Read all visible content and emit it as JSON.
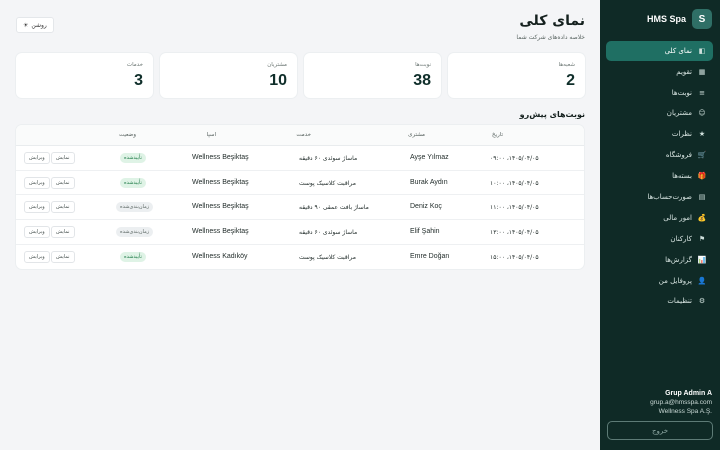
{
  "sidebar": {
    "brand_name": "HMS Spa",
    "brand_initial": "S",
    "items": [
      {
        "label": "نمای کلی",
        "icon": "◧"
      },
      {
        "label": "تقویم",
        "icon": "▦"
      },
      {
        "label": "نوبت‌ها",
        "icon": "≡"
      },
      {
        "label": "مشتریان",
        "icon": "☺"
      },
      {
        "label": "نظرات",
        "icon": "★"
      },
      {
        "label": "فروشگاه",
        "icon": "🛒"
      },
      {
        "label": "بسته‌ها",
        "icon": "🎁"
      },
      {
        "label": "صورت‌حساب‌ها",
        "icon": "▤"
      },
      {
        "label": "امور مالی",
        "icon": "💰"
      },
      {
        "label": "کارکنان",
        "icon": "⚑"
      },
      {
        "label": "گزارش‌ها",
        "icon": "📊"
      },
      {
        "label": "پروفایل من",
        "icon": "👤"
      },
      {
        "label": "تنظیمات",
        "icon": "⚙"
      }
    ],
    "user": {
      "name": "Grup Admin A",
      "email": "grup.a@hmsspa.com",
      "company": "Wellness Spa A.Ş."
    },
    "logout_label": "خروج"
  },
  "header": {
    "title": "نمای کلی",
    "subtitle": "خلاصه داده‌های شرکت شما",
    "theme_label": "روشن",
    "theme_icon": "☀"
  },
  "stats": [
    {
      "label": "شعبه‌ها",
      "value": "2"
    },
    {
      "label": "نوبت‌ها",
      "value": "38"
    },
    {
      "label": "مشتریان",
      "value": "10"
    },
    {
      "label": "خدمات",
      "value": "3"
    }
  ],
  "upcoming": {
    "title": "نوبت‌های پیش‌رو",
    "columns": {
      "date": "تاریخ",
      "customer": "مشتری",
      "service": "خدمت",
      "location": "اسپا",
      "status": "وضعیت"
    },
    "view_label": "نمایش",
    "edit_label": "ویرایش",
    "rows": [
      {
        "date": "۱۴۰۵/۰۴/۰۵، ۰۹:۰۰",
        "customer": "Ayşe Yılmaz",
        "service": "ماساژ سوئدی ۶۰ دقیقه",
        "location": "Wellness Beşiktaş",
        "status": "تأییدشده",
        "status_kind": "ok"
      },
      {
        "date": "۱۴۰۵/۰۴/۰۵، ۱۰:۰۰",
        "customer": "Burak Aydın",
        "service": "مراقبت کلاسیک پوست",
        "location": "Wellness Beşiktaş",
        "status": "تأییدشده",
        "status_kind": "ok"
      },
      {
        "date": "۱۴۰۵/۰۴/۰۵، ۱۱:۰۰",
        "customer": "Deniz Koç",
        "service": "ماساژ بافت عمقی ۹۰ دقیقه",
        "location": "Wellness Beşiktaş",
        "status": "زمان‌بندی‌شده",
        "status_kind": "pend"
      },
      {
        "date": "۱۴۰۵/۰۴/۰۵، ۱۳:۰۰",
        "customer": "Elif Şahin",
        "service": "ماساژ سوئدی ۶۰ دقیقه",
        "location": "Wellness Beşiktaş",
        "status": "زمان‌بندی‌شده",
        "status_kind": "pend"
      },
      {
        "date": "۱۴۰۵/۰۴/۰۵، ۱۵:۰۰",
        "customer": "Emre Doğan",
        "service": "مراقبت کلاسیک پوست",
        "location": "Wellness Kadıköy",
        "status": "تأییدشده",
        "status_kind": "ok"
      }
    ]
  }
}
